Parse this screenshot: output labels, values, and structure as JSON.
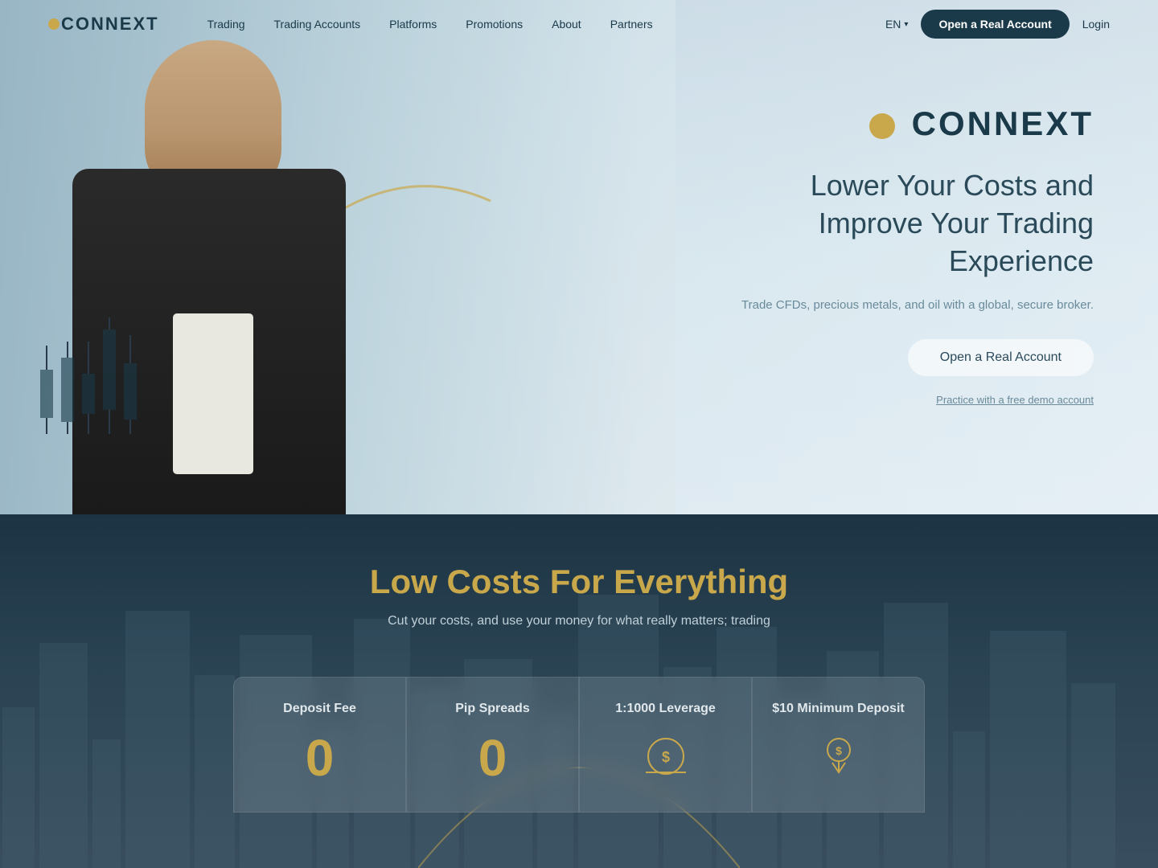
{
  "brand": {
    "name": "CONNEXT",
    "logo_text": "CONNEXT"
  },
  "nav": {
    "links": [
      {
        "label": "Trading",
        "id": "trading"
      },
      {
        "label": "Trading Accounts",
        "id": "trading-accounts"
      },
      {
        "label": "Platforms",
        "id": "platforms"
      },
      {
        "label": "Promotions",
        "id": "promotions"
      },
      {
        "label": "About",
        "id": "about"
      },
      {
        "label": "Partners",
        "id": "partners"
      }
    ],
    "lang": "EN",
    "open_account_label": "Open a Real Account",
    "login_label": "Login"
  },
  "hero": {
    "logo_text": "CONNEXT",
    "headline_line1": "Lower Your Costs and",
    "headline_line2": "Improve Your Trading Experience",
    "subtext": "Trade CFDs, precious metals, and oil with a global, secure broker.",
    "cta_primary": "Open a Real Account",
    "cta_secondary": "Practice with a free demo account"
  },
  "costs": {
    "title": "Low Costs For Everything",
    "subtitle": "Cut your costs, and use your money for what really matters; trading",
    "stats": [
      {
        "label": "Deposit Fee",
        "value": "0",
        "type": "number"
      },
      {
        "label": "Pip Spreads",
        "value": "0",
        "type": "number"
      },
      {
        "label": "1:1000 Leverage",
        "value": "",
        "type": "icon"
      },
      {
        "label": "$10 Minimum Deposit",
        "value": "",
        "type": "icon"
      }
    ]
  }
}
